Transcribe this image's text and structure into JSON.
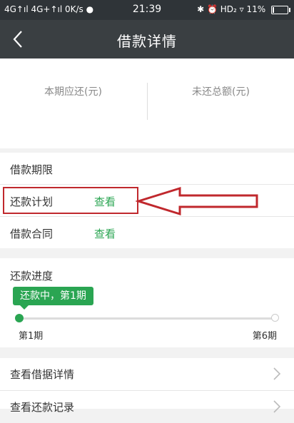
{
  "status_bar": {
    "left_text": "4G↑ıl  4G+↑ıl 0K/s ●",
    "time": "21:39",
    "right_text": "✱ ⏰ HD₂ ▿ 11%",
    "battery_level": 0.11
  },
  "nav": {
    "title": "借款详情"
  },
  "summary": {
    "current_due_label": "本期应还(元)",
    "total_unpaid_label": "未还总额(元)"
  },
  "loan_info": {
    "term_label": "借款期限",
    "plan_label": "还款计划",
    "plan_link": "查看",
    "contract_label": "借款合同",
    "contract_link": "查看"
  },
  "progress": {
    "title": "还款进度",
    "status": "还款中，第1期",
    "start_label": "第1期",
    "end_label": "第6期",
    "current_period": 1,
    "total_periods": 6
  },
  "bottom_menu": {
    "loan_detail_label": "查看借据详情",
    "repay_record_label": "查看还款记录"
  },
  "colors": {
    "accent_green": "#2aa552",
    "annotation_red": "#c0282d",
    "nav_bg": "#3a3f42"
  }
}
